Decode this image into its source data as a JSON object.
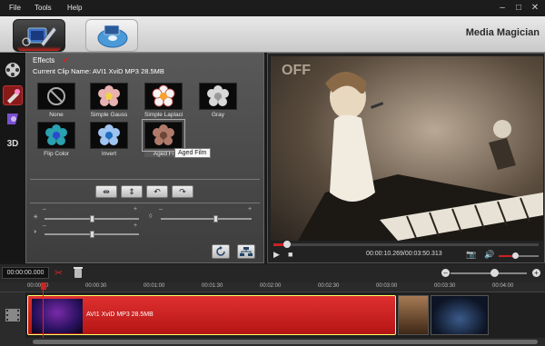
{
  "menu": {
    "file": "File",
    "tools": "Tools",
    "help": "Help"
  },
  "window": {
    "minimize": "–",
    "restore": "□",
    "close": "✕"
  },
  "app_title": "Media Magician",
  "effects": {
    "title": "Effects",
    "clip_name": "Current Clip Name:  AVI1 XviD MP3 28.5MB",
    "items": [
      {
        "name": "None"
      },
      {
        "name": "Simple Gauss"
      },
      {
        "name": "Simple Laplaci"
      },
      {
        "name": "Gray"
      },
      {
        "name": "Flip Color"
      },
      {
        "name": "Invert"
      },
      {
        "name": "Aged Fi"
      }
    ],
    "tooltip": "Aged Film",
    "minus": "–",
    "plus": "+"
  },
  "sliders": {
    "brightness": 0.5,
    "contrast": 0.5,
    "saturation": 0.5,
    "tint": 0.6
  },
  "player": {
    "time": "00:00:10.269/00:03:50.313",
    "progress": 0.05,
    "volume": 0.4
  },
  "timeline": {
    "timecode": "00:00:00.000",
    "ruler": [
      "00:00:00",
      "00:00:30",
      "00:01:00",
      "00:01:30",
      "00:02:00",
      "00:02:30",
      "00:03:00",
      "00:03:30",
      "00:04:00"
    ],
    "clip_label": "AVI1 XviD MP3 28.5MB",
    "zoom_minus": "–",
    "zoom_plus": "+"
  },
  "colors": {
    "accent": "#d02a2a",
    "clip": "#c91f1f",
    "panel": "#4a4a4a"
  }
}
